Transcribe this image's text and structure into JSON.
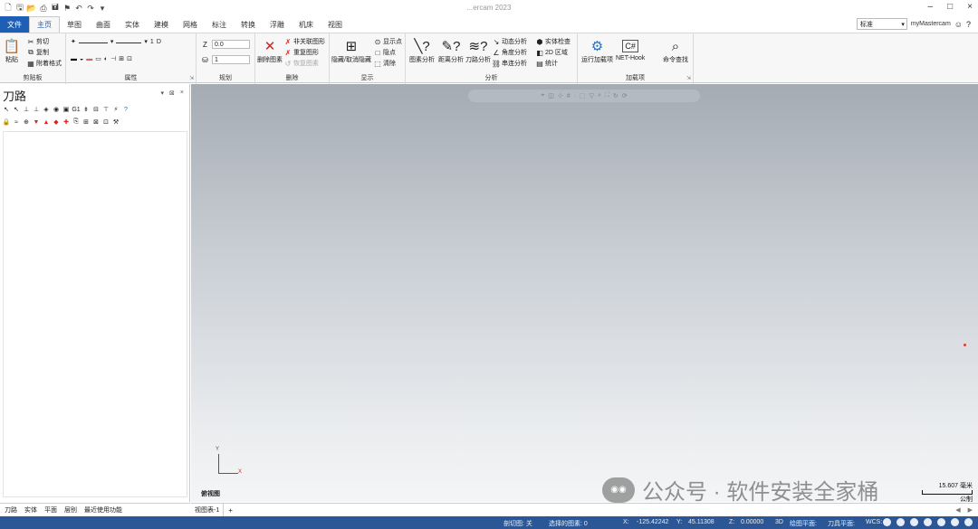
{
  "app": {
    "title": "...ercam 2023"
  },
  "window_controls": [
    "–",
    "□",
    "×"
  ],
  "qat_icons": [
    "new-icon",
    "save-icon",
    "open-icon",
    "print-icon",
    "save-as-icon",
    "tool-icon",
    "undo-icon",
    "redo-icon",
    "more-icon"
  ],
  "ribbon": {
    "tabs": [
      {
        "label": "文件"
      },
      {
        "label": "主页"
      },
      {
        "label": "草图"
      },
      {
        "label": "曲面"
      },
      {
        "label": "实体"
      },
      {
        "label": "建模"
      },
      {
        "label": "网格"
      },
      {
        "label": "标注"
      },
      {
        "label": "转换"
      },
      {
        "label": "浮雕"
      },
      {
        "label": "机床"
      },
      {
        "label": "视图"
      }
    ],
    "active_tab": "主页",
    "right": {
      "style_select": "标准",
      "mymastercam": "myMastercam"
    },
    "clipboard": {
      "label": "剪贴板",
      "paste": "粘贴",
      "cut": "剪切",
      "copy": "复制",
      "paste_special": "附着格式"
    },
    "attributes": {
      "label": "属性",
      "line_width": "1",
      "z_value": "0.0",
      "layer_value": "1"
    },
    "plan": {
      "label": "规划",
      "z_label": "Z"
    },
    "delete": {
      "label": "删除",
      "delete_entity": "删除图素",
      "non_related": "非关联图形",
      "repeat": "重复图形",
      "restore": "恢复图素"
    },
    "display": {
      "label": "显示",
      "hide_show": "隐藏/取消隐藏",
      "show_points": "显示点",
      "hide": "隐点",
      "blank": "清除"
    },
    "analyze": {
      "label": "分析",
      "entity_analysis": "图素分析",
      "distance_analysis": "距离分析",
      "toolpath_analysis": "刀路分析",
      "dynamic_analysis": "动态分析",
      "angle_analysis": "角度分析",
      "chain_analysis": "串连分析",
      "solid_check": "实体检查",
      "2d_area": "2D 区域",
      "statistics": "统计"
    },
    "addins": {
      "label": "加载项",
      "run_addin": "运行加载项",
      "net_hook": "NET-Hook",
      "command_finder": "命令查找"
    }
  },
  "left_panel": {
    "title": "刀路",
    "controls": [
      "▾",
      "⊠",
      "×"
    ],
    "tabs": [
      "刀路",
      "实体",
      "平面",
      "层别",
      "最近使用功能"
    ]
  },
  "viewport": {
    "view_name": "俯视图",
    "axis_y": "Y",
    "axis_x": "X",
    "scale_value": "15.607 毫米",
    "scale_unit": "公制",
    "watermark": "公众号 · 软件安装全家桶",
    "watermark_logo": "wechat-logo"
  },
  "sheet_tabs": {
    "active": "视图表-1",
    "add": "+"
  },
  "status_bar": {
    "section_view": "剖切图: 关",
    "selected_entities": "选择的图素: 0",
    "x": "X:",
    "x_value": "-125.42242",
    "y": "Y:",
    "y_value": "45.11308",
    "z": "Z:",
    "z_value": "0.00000",
    "mode_3d": "3D",
    "cplane": "绘图平面:",
    "tplane": "刀具平面:",
    "wcs": "WCS:"
  },
  "colors": {
    "file_tab": "#1e5fb5",
    "statusbar": "#2b5797",
    "delete_icon": "#d22222",
    "axis_y": "#1f7a1f",
    "axis_x": "#dd2222"
  }
}
